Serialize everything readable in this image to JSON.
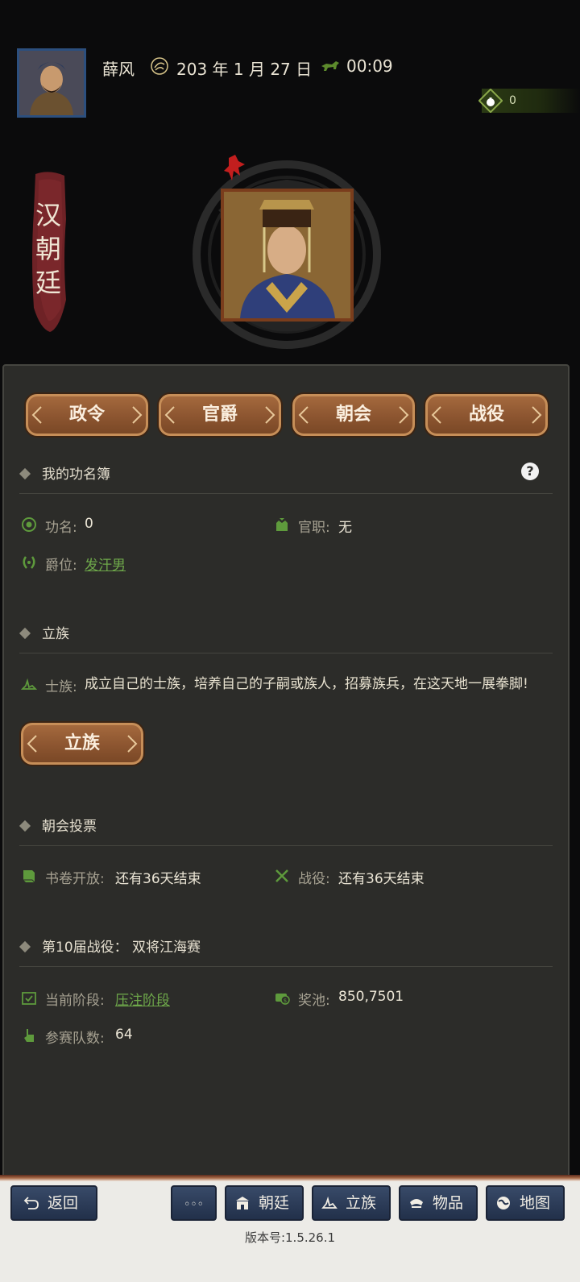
{
  "header": {
    "player_name": "薛风",
    "date": "203 年 1 月 27 日",
    "time": "00:09",
    "resource_value": "0"
  },
  "court": {
    "title": "汉朝廷"
  },
  "tabs": [
    {
      "label": "政令"
    },
    {
      "label": "官爵"
    },
    {
      "label": "朝会"
    },
    {
      "label": "战役"
    }
  ],
  "merit": {
    "title": "我的功名簿",
    "fame_label": "功名:",
    "fame_value": "0",
    "office_label": "官职:",
    "office_value": "无",
    "rank_label": "爵位:",
    "rank_value": "发汗男"
  },
  "clan": {
    "title": "立族",
    "label": "士族:",
    "description": "成立自己的士族，培养自己的子嗣或族人，招募族兵，在这天地一展拳脚!",
    "button_label": "立族"
  },
  "vote": {
    "title": "朝会投票",
    "books_label": "书卷开放:",
    "books_value": "还有36天结束",
    "battle_label": "战役:",
    "battle_value": "还有36天结束"
  },
  "campaign": {
    "title": "第10届战役： 双将江海赛",
    "stage_label": "当前阶段:",
    "stage_value": "压注阶段",
    "pool_label": "奖池:",
    "pool_value": "850,7501",
    "teams_label": "参赛队数:",
    "teams_value": "64"
  },
  "bottom_nav": {
    "back": "返回",
    "more": "◦◦◦",
    "court": "朝廷",
    "clan": "立族",
    "items": "物品",
    "map": "地图"
  },
  "version": "版本号:1.5.26.1",
  "colors": {
    "panel_bg": "#2c2c29",
    "button_brown": "#8c5530",
    "link_green": "#6ea84a",
    "nav_blue": "#2b3b58"
  }
}
